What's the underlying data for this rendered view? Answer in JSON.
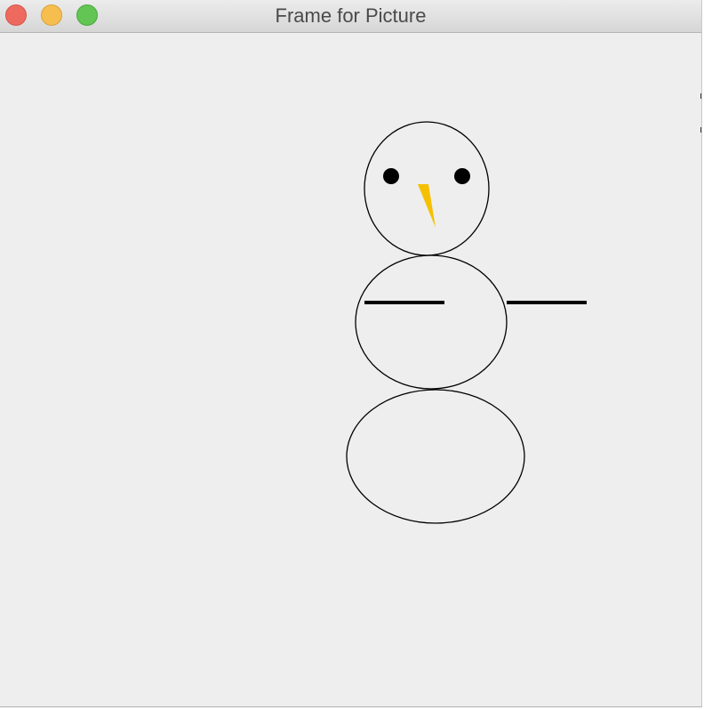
{
  "window": {
    "title": "Frame for Picture",
    "controls": {
      "close": {
        "color": "#ee6a5f",
        "icon": "close-circle"
      },
      "minimize": {
        "color": "#f5be4f",
        "icon": "minimize-circle"
      },
      "zoom": {
        "color": "#62c554",
        "icon": "zoom-circle"
      }
    }
  },
  "drawing": {
    "background": "#eeeeee",
    "outline_color": "#000000",
    "nose_color": "#f6c002",
    "eye_color": "#000000",
    "arm_color": "#000000",
    "parts": [
      "head",
      "left-eye",
      "right-eye",
      "nose",
      "middle-body",
      "left-arm",
      "right-arm",
      "bottom-body"
    ]
  }
}
